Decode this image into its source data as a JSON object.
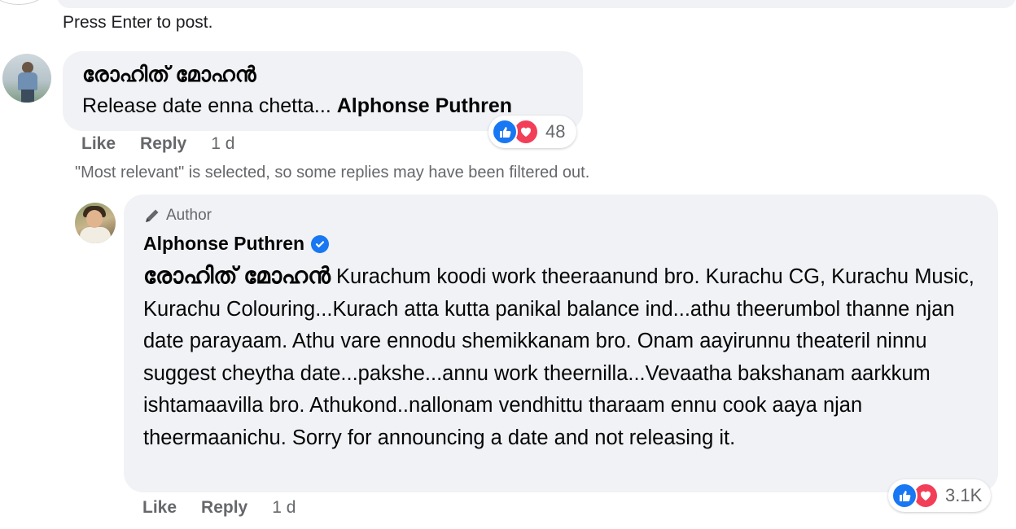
{
  "composer": {
    "hint": "Press Enter to post."
  },
  "comment": {
    "author": "രോഹിത് മോഹൻ",
    "text": "Release date enna chetta... ",
    "mention": "Alphonse Puthren",
    "reaction_count": "48",
    "actions": {
      "like": "Like",
      "reply": "Reply",
      "time": "1 d"
    },
    "reactions": [
      "like-icon",
      "love-icon"
    ]
  },
  "filter_notice": "\"Most relevant\" is selected, so some replies may have been filtered out.",
  "reply": {
    "badge": "Author",
    "author": "Alphonse Puthren",
    "verified": true,
    "mention": "രോഹിത് മോഹൻ",
    "text": " Kurachum koodi work theeraanund bro. Kurachu CG, Kurachu Music, Kurachu Colouring...Kurach atta kutta panikal balance ind...athu theerumbol thanne njan date parayaam. Athu vare ennodu shemikkanam bro. Onam aayirunnu theateril ninnu suggest cheytha date...pakshe...annu work theernilla...Vevaatha bakshanam aarkkum ishtamaavilla bro. Athukond..nallonam vendhittu tharaam ennu cook aaya njan theermaanichu. Sorry for announcing a date and not releasing it.",
    "reaction_count": "3.1K",
    "actions": {
      "like": "Like",
      "reply": "Reply",
      "time": "1 d"
    },
    "reactions": [
      "like-icon",
      "love-icon"
    ]
  },
  "colors": {
    "bubble": "#f0f2f5",
    "like": "#1877f2",
    "love": "#f33e58",
    "secondary_text": "#65676b"
  }
}
